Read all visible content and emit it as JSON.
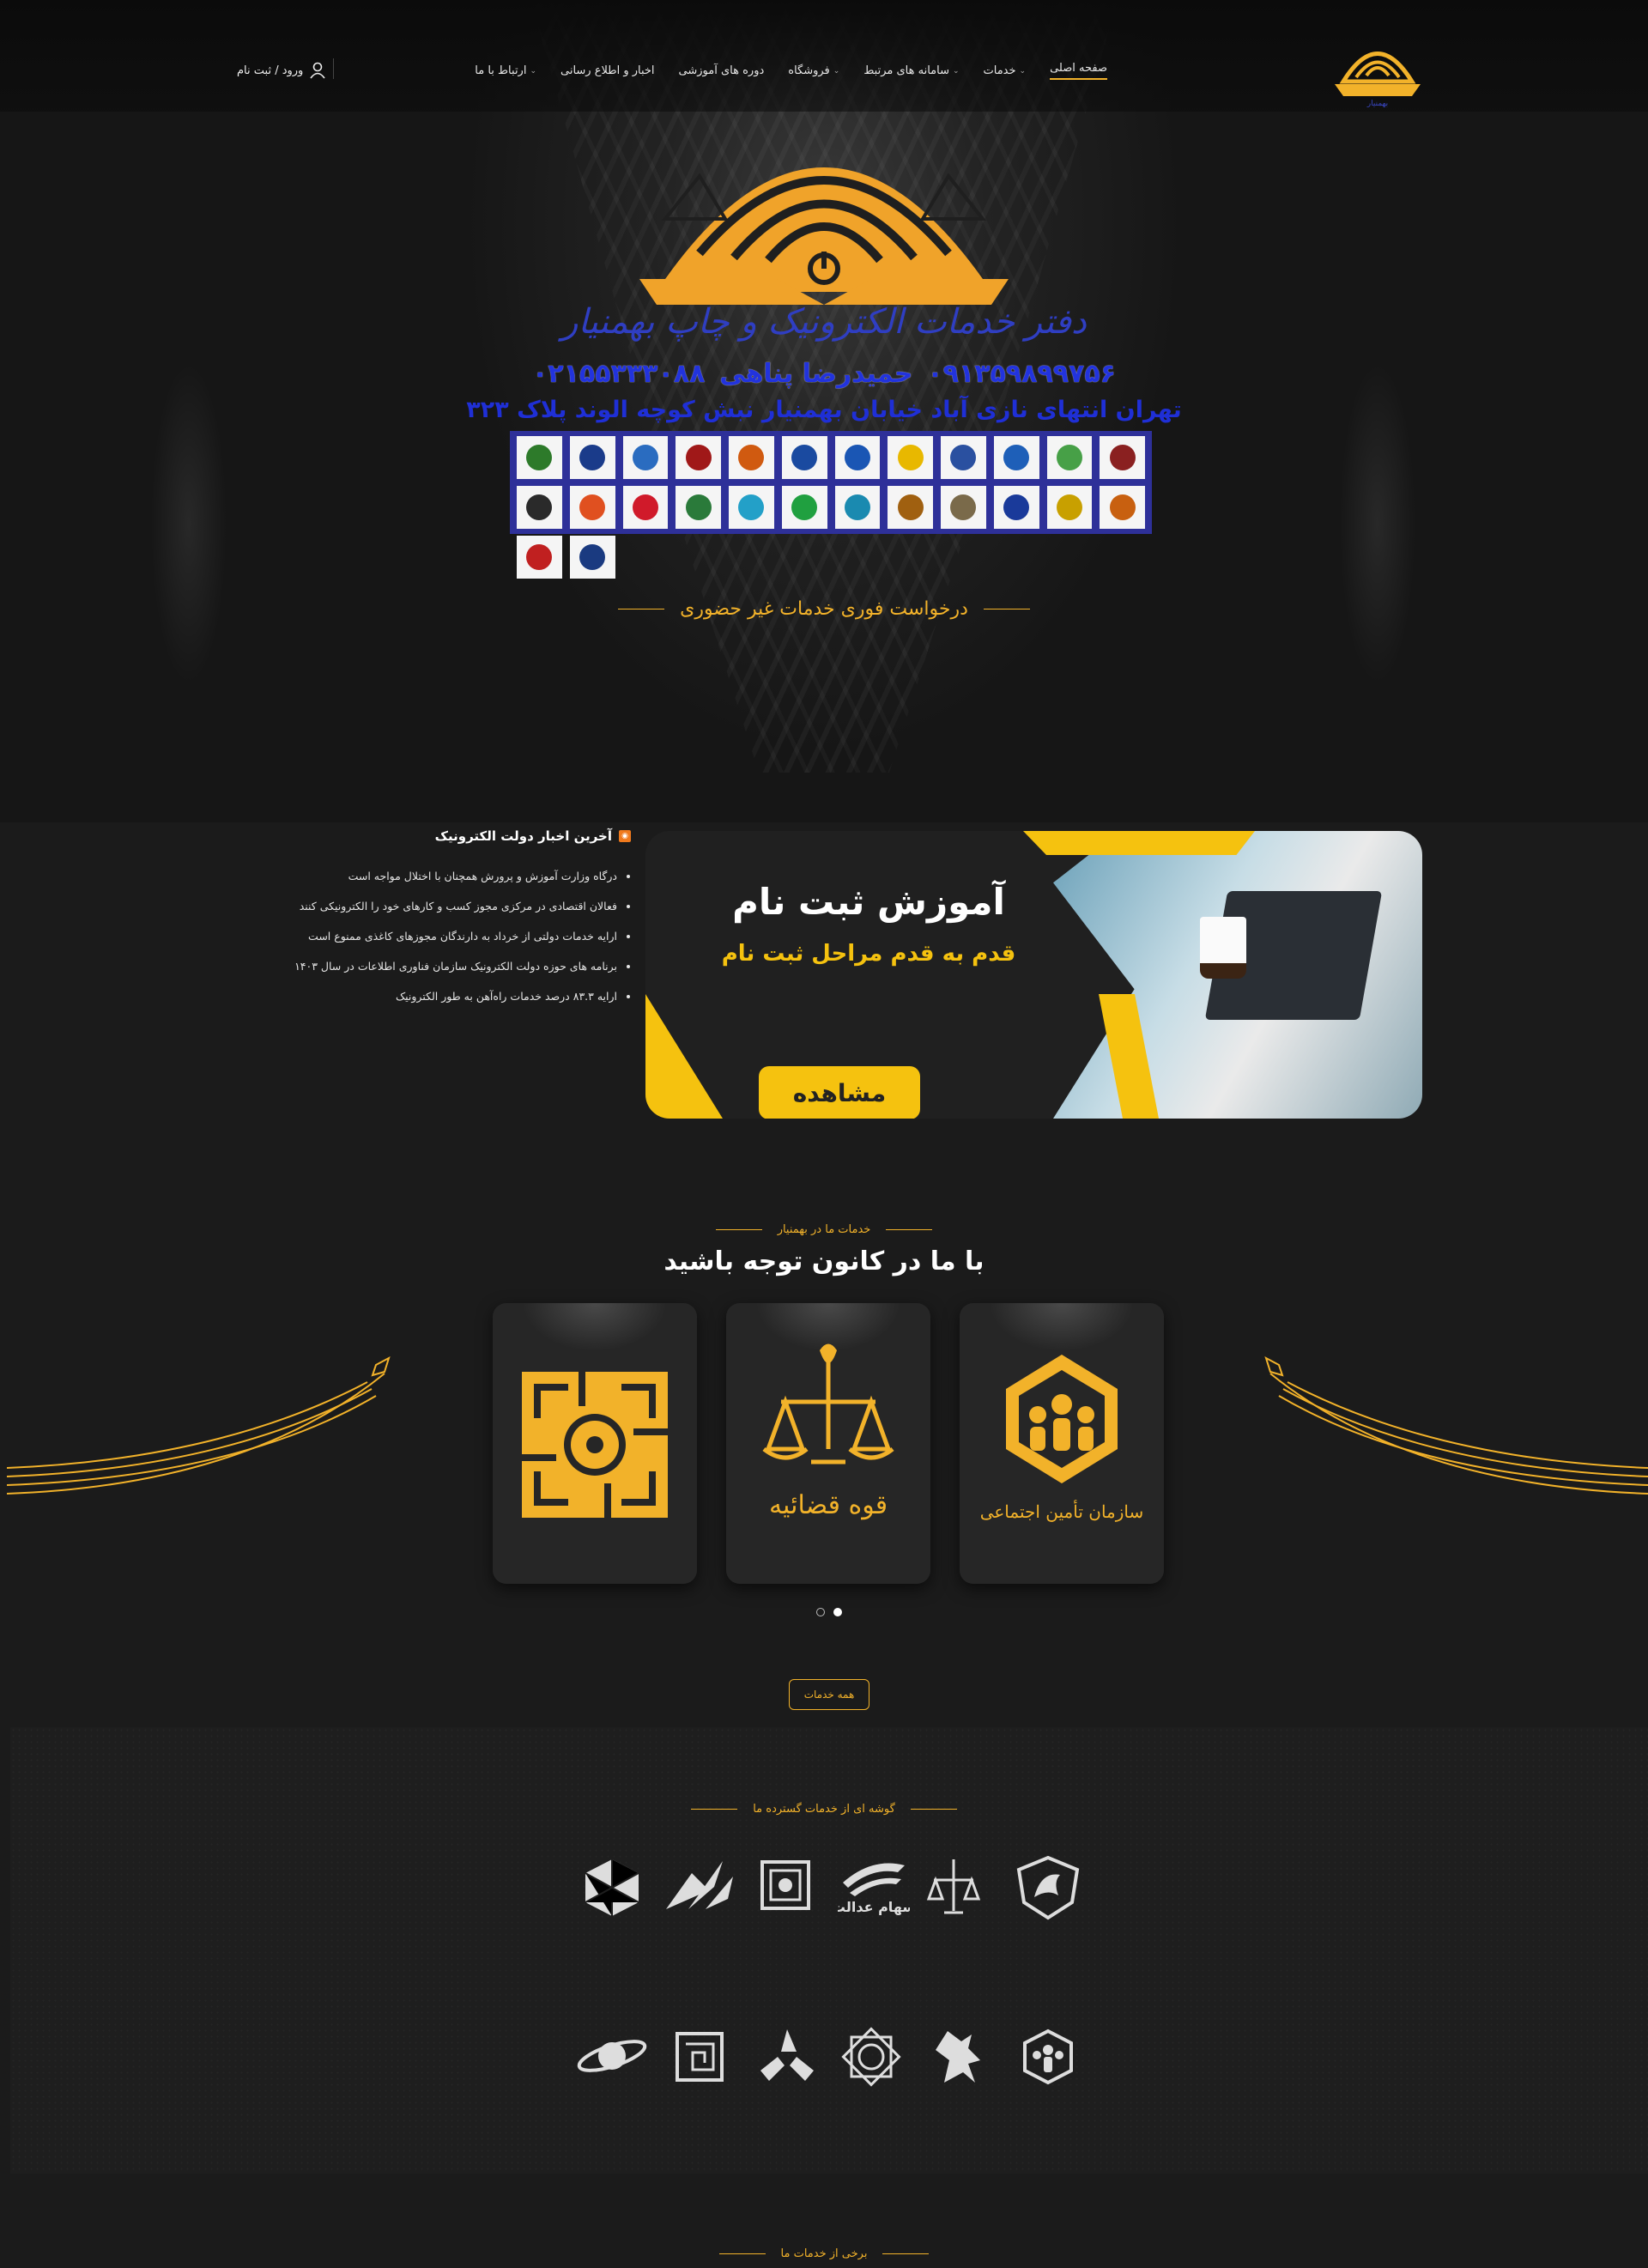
{
  "nav": {
    "items": [
      {
        "label": "صفحه اصلی",
        "active": true,
        "dropdown": false
      },
      {
        "label": "خدمات",
        "dropdown": true
      },
      {
        "label": "سامانه های مرتبط",
        "dropdown": true
      },
      {
        "label": "فروشگاه",
        "dropdown": true
      },
      {
        "label": "دوره های آموزشی",
        "dropdown": false
      },
      {
        "label": "اخبار و اطلاع رسانی",
        "dropdown": false
      },
      {
        "label": "ارتباط با ما",
        "dropdown": true
      }
    ],
    "login_label": "ورود / ثبت نام"
  },
  "hero": {
    "logo_caption": "دفتر خدمات الکترونیک و چاپ بهمنیار",
    "name": "حمیدرضا پناهی",
    "phone_mobile": "۰۹۱۳۵۹۸۹۹۷۵۶",
    "phone_tel": "۰۲۱۵۵۳۳۳۰۸۸",
    "address": "تهران انتهای نازی آباد خیابان بهمنیار نبش کوچه الوند پلاک ۳۲۳",
    "badge_colors": [
      "#2d7a2a",
      "#1a3b8a",
      "#2a6cc0",
      "#a01818",
      "#d05a10",
      "#1a4aa0",
      "#1a56b4",
      "#e8b800",
      "#2a50a0",
      "#1e5fb8",
      "#47a047",
      "#8a2020",
      "#2a2a2a",
      "#e05020",
      "#d01a2a",
      "#2a7a3a",
      "#23a0c8",
      "#20a040",
      "#1a8ab0",
      "#a06010",
      "#7a6a4a",
      "#1a3a9a",
      "#c8a000",
      "#c86010",
      "#c02020",
      "#1a3a80"
    ]
  },
  "request_title": "درخواست فوری خدمات غیر حضوری",
  "news": {
    "heading": "آخرین اخبار دولت الکترونیک",
    "items": [
      "درگاه وزارت آموزش و پرورش همچنان با اختلال مواجه است",
      "فعالان اقتصادی در مرکزی مجوز کسب و کارهای خود را الکترونیکی کنند",
      "ارایه خدمات دولتی از خرداد به دارندگان مجوزهای کاغذی ممنوع است",
      "برنامه های حوزه دولت الکترونیک سازمان فناوری اطلاعات در سال ۱۴۰۳",
      "ارایه ۸۳.۳ درصد خدمات راه‌آهن به طور الکترونیک"
    ]
  },
  "banner": {
    "title": "آموزش ثبت نام",
    "subtitle": "قدم به قدم مراحل ثبت نام",
    "button": "مشاهده"
  },
  "services": {
    "eyebrow": "خدمات ما در بهمنیار",
    "title": "با ما در کانون توجه باشید",
    "cards": [
      {
        "icon": "tax-org-icon"
      },
      {
        "icon": "judiciary-icon",
        "caption": "قوه قضائیه"
      },
      {
        "icon": "social-security-icon",
        "caption": "سازمان تأمین اجتماعی"
      }
    ],
    "all_button": "همه خدمات"
  },
  "partners": {
    "title": "گوشه ای از خدمات گسترده ما",
    "row1": [
      "irankhodro-logo",
      "judiciary-logo",
      "sahame-edalat-logo",
      "tax-logo",
      "post-logo",
      "polygon-logo"
    ],
    "row1_caption": "سهام عدالت",
    "row2": [
      "tamin-logo",
      "peugeot-logo",
      "national-library-logo",
      "saipa-logo",
      "maze-logo",
      "planet-logo"
    ]
  },
  "bottom_title": "برخی از خدمات ما",
  "colors": {
    "accent": "#f2b22a",
    "banner_yellow": "#f5c20f",
    "phone_blue": "#2233dd"
  }
}
